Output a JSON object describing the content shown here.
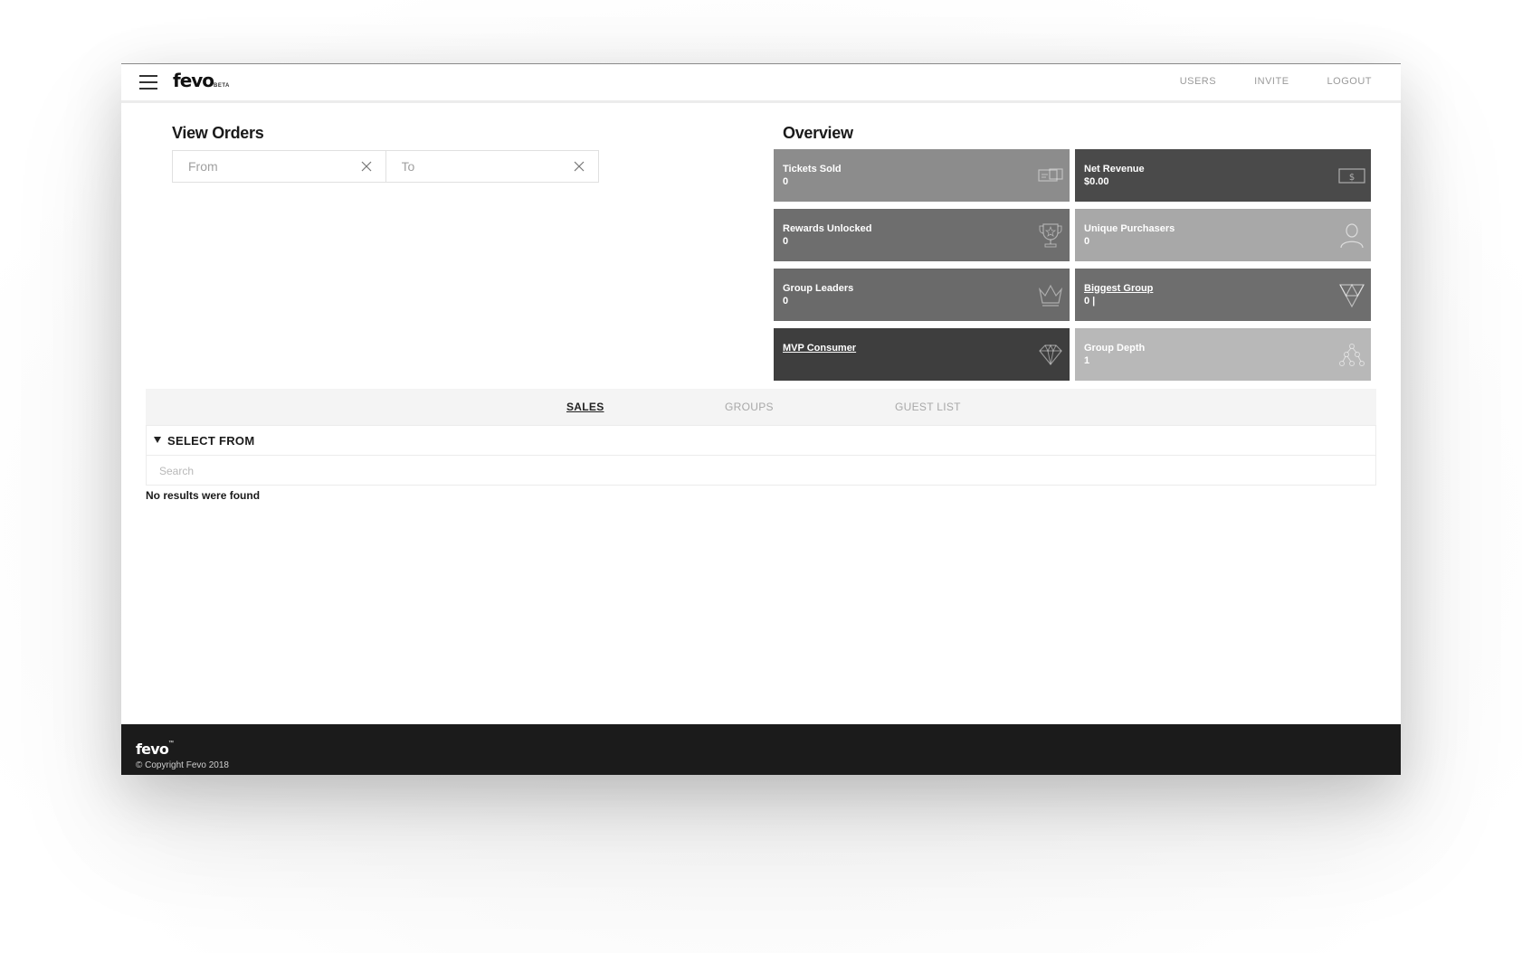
{
  "header": {
    "logo": "fevo",
    "logo_badge": "BETA",
    "nav": [
      "USERS",
      "INVITE",
      "LOGOUT"
    ]
  },
  "orders": {
    "title": "View Orders",
    "from_placeholder": "From",
    "to_placeholder": "To"
  },
  "overview": {
    "title": "Overview",
    "tiles": [
      {
        "label": "Tickets Sold",
        "value": "0",
        "icon": "ticket-icon",
        "color": "#8c8c8c"
      },
      {
        "label": "Net Revenue",
        "value": "$0.00",
        "icon": "dollar-bill-icon",
        "color": "#4a4a4a"
      },
      {
        "label": "Rewards Unlocked",
        "value": "0",
        "icon": "trophy-icon",
        "color": "#6e6e6e"
      },
      {
        "label": "Unique Purchasers",
        "value": "0",
        "icon": "person-icon",
        "color": "#a8a8a8"
      },
      {
        "label": "Group Leaders",
        "value": "0",
        "icon": "crown-icon",
        "color": "#6a6a6a"
      },
      {
        "label": "Biggest Group",
        "value": "0 |",
        "icon": "group-triangle-icon",
        "color": "#6e6e6e"
      },
      {
        "label": "MVP Consumer",
        "value": "",
        "icon": "diamond-icon",
        "color": "#3e3e3e"
      },
      {
        "label": "Group Depth",
        "value": "1",
        "icon": "hierarchy-icon",
        "color": "#b8b8b8"
      }
    ]
  },
  "tabs": {
    "items": [
      "SALES",
      "GROUPS",
      "GUEST LIST"
    ],
    "active": "SALES"
  },
  "filter": {
    "select_label": "SELECT FROM",
    "search_placeholder": "Search",
    "empty_message": "No results were found"
  },
  "footer": {
    "logo": "fevo",
    "trademark": "™",
    "copyright": "© Copyright Fevo 2018"
  }
}
